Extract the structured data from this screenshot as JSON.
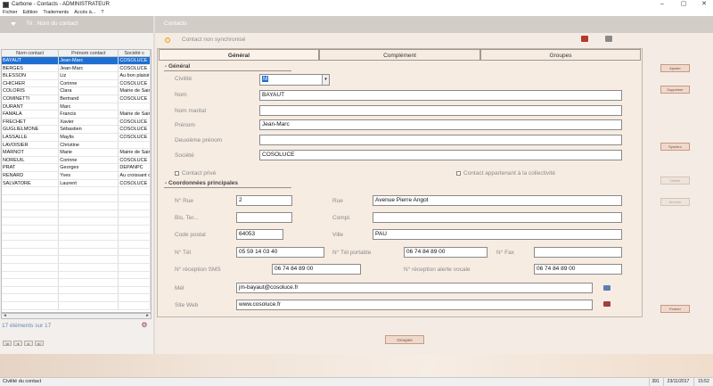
{
  "window": {
    "title": "Carbone - Contacts - ADMINISTRATEUR",
    "min": "–",
    "max": "▢",
    "close": "✕"
  },
  "menu": [
    "Fichier",
    "Edition",
    "Traitements",
    "Accès à...",
    "?"
  ],
  "left_header": {
    "label": "Tri : Nom du contact"
  },
  "right_header": {
    "label": "Contacts"
  },
  "table": {
    "columns": [
      "Nom contact",
      "Prénom contact",
      "Société c"
    ],
    "rows": [
      [
        "BAYAUT",
        "Jean-Marc",
        "COSOLUCE"
      ],
      [
        "BERGES",
        "Jean-Marc",
        "COSOLUCE"
      ],
      [
        "BLESSON",
        "Liz",
        "Au bon plaisir"
      ],
      [
        "CHICHER",
        "Corinne",
        "COSOLUCE"
      ],
      [
        "COLORIS",
        "Clara",
        "Mairie de Sain"
      ],
      [
        "COMINETTI",
        "Bertrand",
        "COSOLUCE"
      ],
      [
        "DURANT",
        "Marc",
        ""
      ],
      [
        "FAMALA",
        "Francis",
        "Mairie de Sain"
      ],
      [
        "FRECHET",
        "Xavier",
        "COSOLUCE"
      ],
      [
        "GUGLIELMONE",
        "Sébastien",
        "COSOLUCE"
      ],
      [
        "LASSALLE",
        "Maylis",
        "COSOLUCE"
      ],
      [
        "LAVOISIER",
        "Christine",
        ""
      ],
      [
        "MARNOT",
        "Marie",
        "Mairie de Sain"
      ],
      [
        "NOREUIL",
        "Corinne",
        "COSOLUCE"
      ],
      [
        "PRAT",
        "Georges",
        "DEPANPC"
      ],
      [
        "RENARD",
        "Yves",
        "Au croissant d"
      ],
      [
        "SALVATORE",
        "Laurent",
        "COSOLUCE"
      ]
    ],
    "selected_index": 0
  },
  "count_label": "17 éléments sur 17",
  "sync": {
    "text": "Contact non synchronisé"
  },
  "tabs": [
    "Général",
    "Complément",
    "Groupes"
  ],
  "general": {
    "section_title": "- Général",
    "civilite_label": "Civilité",
    "civilite_value": "M",
    "nom_label": "Nom",
    "nom_value": "BAYAUT",
    "nom_marital_label": "Nom marital",
    "nom_marital_value": "",
    "prenom_label": "Prénom",
    "prenom_value": "Jean-Marc",
    "deuxieme_prenom_label": "Deuxième prénom",
    "deuxieme_prenom_value": "",
    "societe_label": "Société",
    "societe_value": "COSOLUCE",
    "contact_prive_label": "Contact privé",
    "collectivite_label": "Contact appartenant à la collectivité"
  },
  "coord": {
    "section_title": "- Coordonnées principales",
    "num_rue_label": "N° Rue",
    "num_rue_value": "2",
    "rue_label": "Rue",
    "rue_value": "Avenue Pierre Angot",
    "bis_ter_label": "Bis, Ter...",
    "bis_ter_value": "",
    "compl_label": "Compl.",
    "compl_value": "",
    "code_postal_label": "Code postal",
    "code_postal_value": "64053",
    "ville_label": "Ville",
    "ville_value": "PAU",
    "tel_label": "N° Tél",
    "tel_value": "05 59 14 03 40",
    "tel_portable_label": "N° Tél portable",
    "tel_portable_value": "06 74 84 89 00",
    "fax_label": "N° Fax",
    "fax_value": "",
    "sms_label": "N° réception SMS",
    "sms_value": "06 74 84 89 00",
    "vocale_label": "N° réception alerte vocale",
    "vocale_value": "06 74 84 89 00",
    "mel_label": "Mél",
    "mel_value": "jm-bayaut@cosoluce.fr",
    "web_label": "Site Web",
    "web_value": "www.cosoluce.fr"
  },
  "buttons": {
    "ajouter": "Ajouter",
    "supprimer": "Supprimer",
    "synchro": "Synchro",
    "valider": "Valider",
    "annuler": "Annuler",
    "fermer": "Fermer",
    "groupes": "Groupes"
  },
  "status": {
    "text": "Civilité du contact",
    "cell1": "391",
    "date": "23/11/2017",
    "time": "15:52"
  }
}
